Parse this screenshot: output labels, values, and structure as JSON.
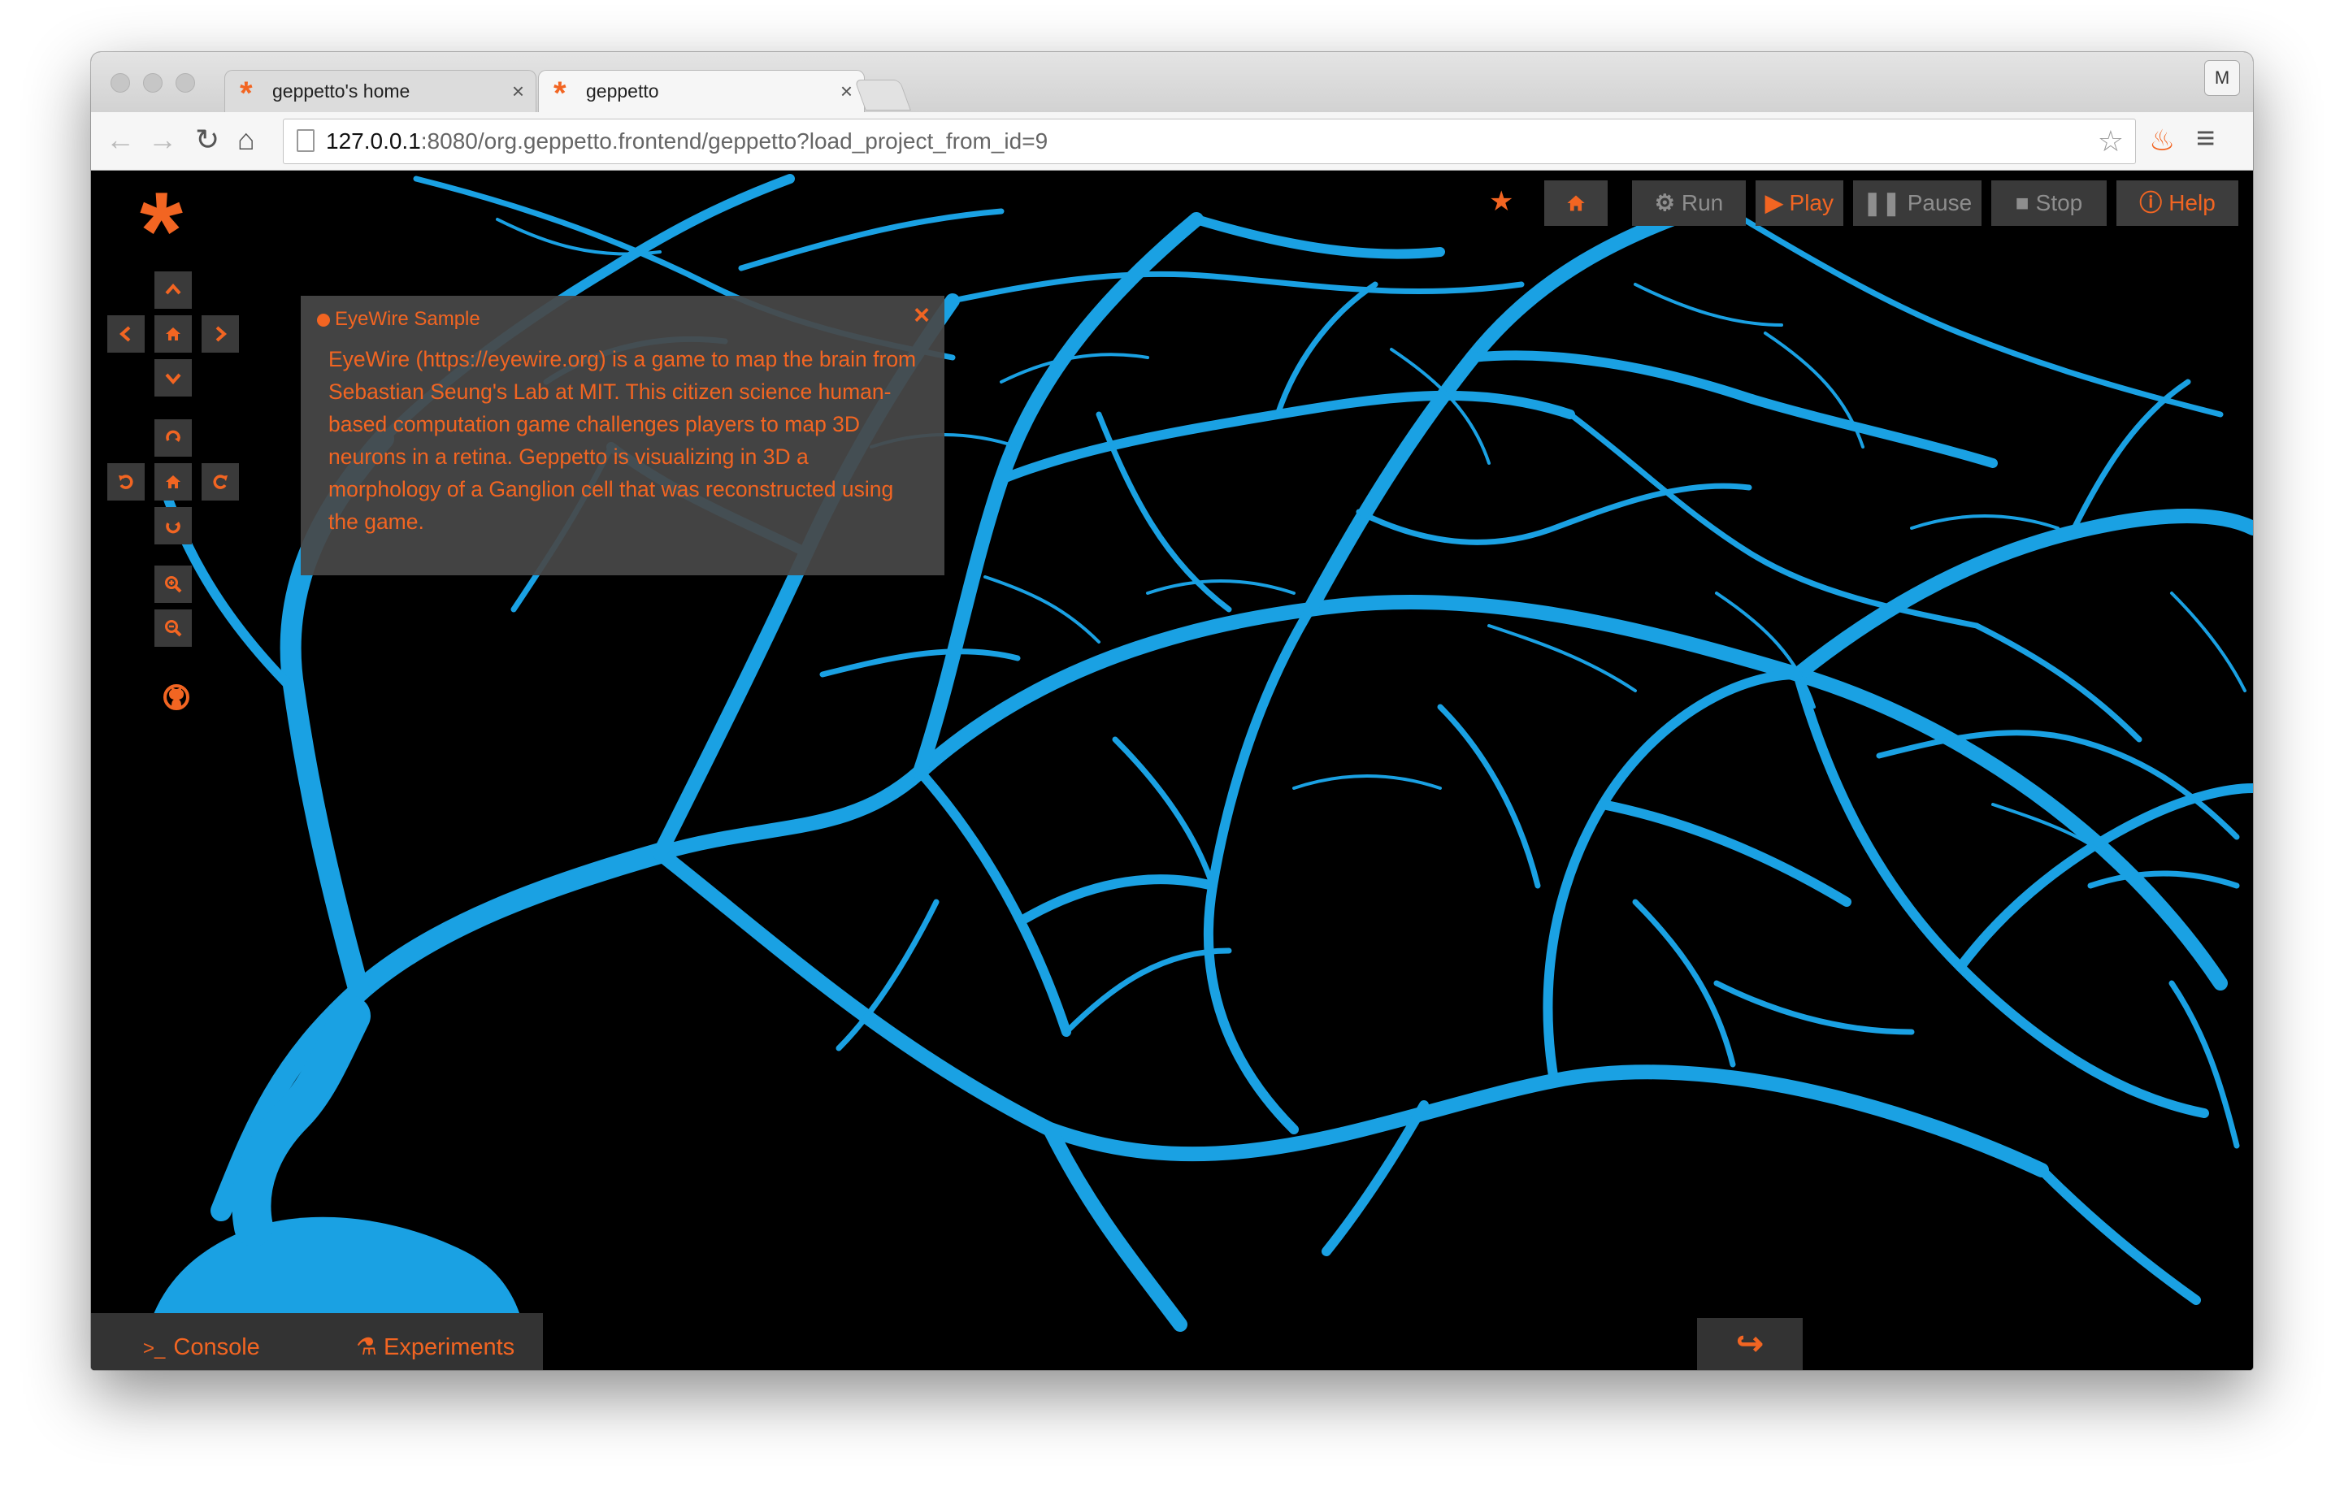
{
  "browser": {
    "tabs": [
      {
        "title": "geppetto's home",
        "active": false
      },
      {
        "title": "geppetto",
        "active": true
      }
    ],
    "profile_initial": "M",
    "url": {
      "host": "127.0.0.1",
      "rest": ":8080/org.geppetto.frontend/geppetto?load_project_from_id=9"
    }
  },
  "popup": {
    "title": "EyeWire Sample",
    "body": "EyeWire (https://eyewire.org) is a game to map the brain from Sebastian Seung's Lab at MIT. This citizen science human-based computation game challenges players to map 3D neurons in a retina. Geppetto is visualizing in 3D a morphology of a Ganglion cell that was reconstructed using the game."
  },
  "sim_toolbar": {
    "run": "Run",
    "play": "Play",
    "pause": "Pause",
    "stop": "Stop",
    "help": "Help"
  },
  "bottom": {
    "console": "Console",
    "experiments": "Experiments"
  },
  "colors": {
    "accent": "#f26522",
    "neuron": "#1aa1e3",
    "panel": "#3a3a3a"
  }
}
